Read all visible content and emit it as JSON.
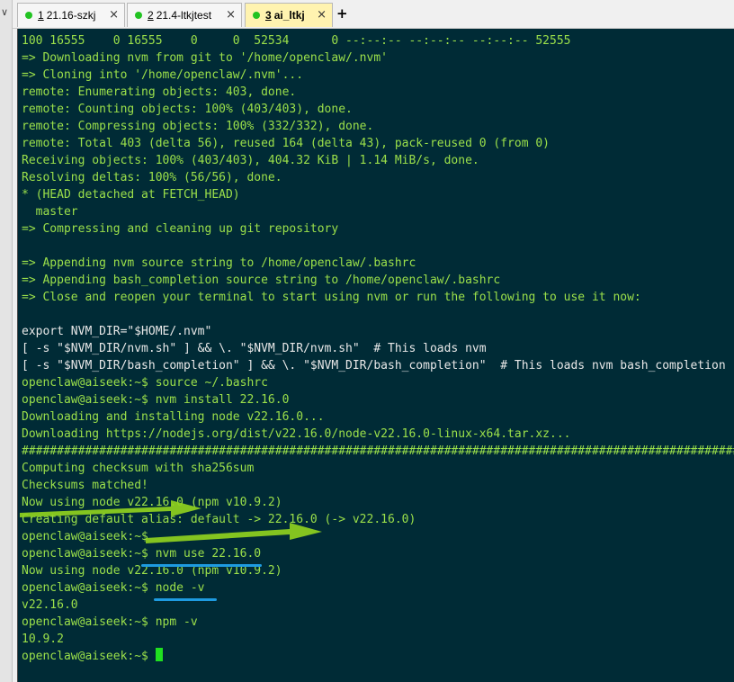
{
  "tabs": [
    {
      "num": "1",
      "label": "21.16-szkj",
      "close": "×",
      "active": false
    },
    {
      "num": "2",
      "label": "21.4-ltkjtest",
      "close": "×",
      "active": false
    },
    {
      "num": "3",
      "label": "ai_ltkj",
      "close": "×",
      "active": true
    }
  ],
  "new_tab_label": "+",
  "chevron": "∨",
  "colors": {
    "terminal_bg": "#002b36",
    "green_text": "#9be04a",
    "white_text": "#e8e8e8",
    "active_tab": "#fff3b0",
    "tab_dot": "#22c322",
    "arrow": "#8fd11e",
    "underline": "#1e9be0"
  },
  "terminal": {
    "lines": [
      "100 16555    0 16555    0     0  52534      0 --:--:-- --:--:-- --:--:-- 52555",
      "=> Downloading nvm from git to '/home/openclaw/.nvm'",
      "=> Cloning into '/home/openclaw/.nvm'...",
      "remote: Enumerating objects: 403, done.",
      "remote: Counting objects: 100% (403/403), done.",
      "remote: Compressing objects: 100% (332/332), done.",
      "remote: Total 403 (delta 56), reused 164 (delta 43), pack-reused 0 (from 0)",
      "Receiving objects: 100% (403/403), 404.32 KiB | 1.14 MiB/s, done.",
      "Resolving deltas: 100% (56/56), done.",
      "* (HEAD detached at FETCH_HEAD)",
      "  master",
      "=> Compressing and cleaning up git repository",
      "",
      "=> Appending nvm source string to /home/openclaw/.bashrc",
      "=> Appending bash_completion source string to /home/openclaw/.bashrc",
      "=> Close and reopen your terminal to start using nvm or run the following to use it now:",
      "",
      "export NVM_DIR=\"$HOME/.nvm\"",
      "[ -s \"$NVM_DIR/nvm.sh\" ] && \\. \"$NVM_DIR/nvm.sh\"  # This loads nvm",
      "[ -s \"$NVM_DIR/bash_completion\" ] && \\. \"$NVM_DIR/bash_completion\"  # This loads nvm bash_completion",
      "openclaw@aiseek:~$ source ~/.bashrc",
      "openclaw@aiseek:~$ nvm install 22.16.0",
      "Downloading and installing node v22.16.0...",
      "Downloading https://nodejs.org/dist/v22.16.0/node-v22.16.0-linux-x64.tar.xz...",
      "########################################################################################################",
      "Computing checksum with sha256sum",
      "Checksums matched!",
      "Now using node v22.16.0 (npm v10.9.2)",
      "Creating default alias: default -> 22.16.0 (-> v22.16.0)",
      "openclaw@aiseek:~$",
      "openclaw@aiseek:~$ nvm use 22.16.0",
      "Now using node v22.16.0 (npm v10.9.2)",
      "openclaw@aiseek:~$ node -v",
      "v22.16.0",
      "openclaw@aiseek:~$ npm -v",
      "10.9.2",
      "openclaw@aiseek:~$ "
    ]
  }
}
